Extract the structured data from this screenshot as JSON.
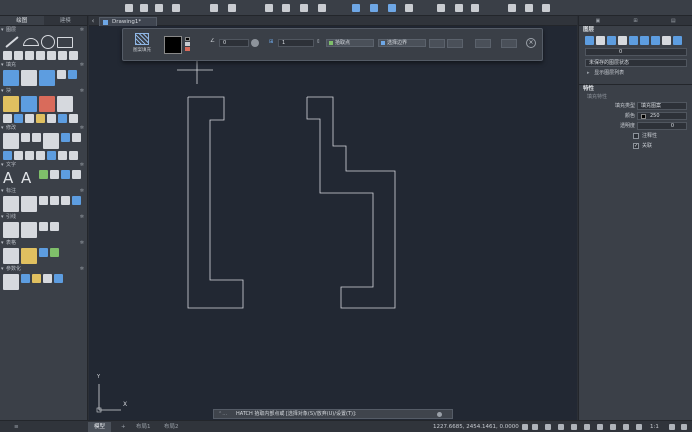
{
  "left_panel": {
    "tabs": [
      "绘图",
      "建模"
    ],
    "sections": [
      "图层",
      "填充",
      "块",
      "修改",
      "文字",
      "标注",
      "引线",
      "表格",
      "参数化"
    ]
  },
  "document": {
    "tab_title": "Drawing1*"
  },
  "hatch_panel": {
    "pattern_label": "图案填充",
    "angle": "0",
    "scale": "1",
    "pick_points": "拾取点",
    "select_boundary": "选择边界"
  },
  "right_panel": {
    "layers_title": "图层",
    "layer_value": "0",
    "unsaved_state": "未保存的图层状态",
    "show_layer_list": "显示图层列表",
    "properties_title": "特性",
    "hatch_props": "填充特性",
    "rows": [
      {
        "label": "填充类型",
        "value": "填充图案"
      },
      {
        "label": "颜色",
        "value": "250"
      },
      {
        "label": "透明度",
        "value": "0"
      }
    ],
    "checkboxes": [
      {
        "label": "注释性",
        "checked": false
      },
      {
        "label": "关联",
        "checked": true
      }
    ]
  },
  "command": {
    "prompt": "HATCH 拾取内部点或 [选择对象(S)/放弃(U)/设置(T)]:"
  },
  "status": {
    "tabs": [
      "模型",
      "布局1",
      "布局2"
    ],
    "coords": "1227.6685, 2454.1461, 0.0000",
    "scale": "1:1"
  },
  "ucs": {
    "x": "X",
    "y": "Y"
  }
}
